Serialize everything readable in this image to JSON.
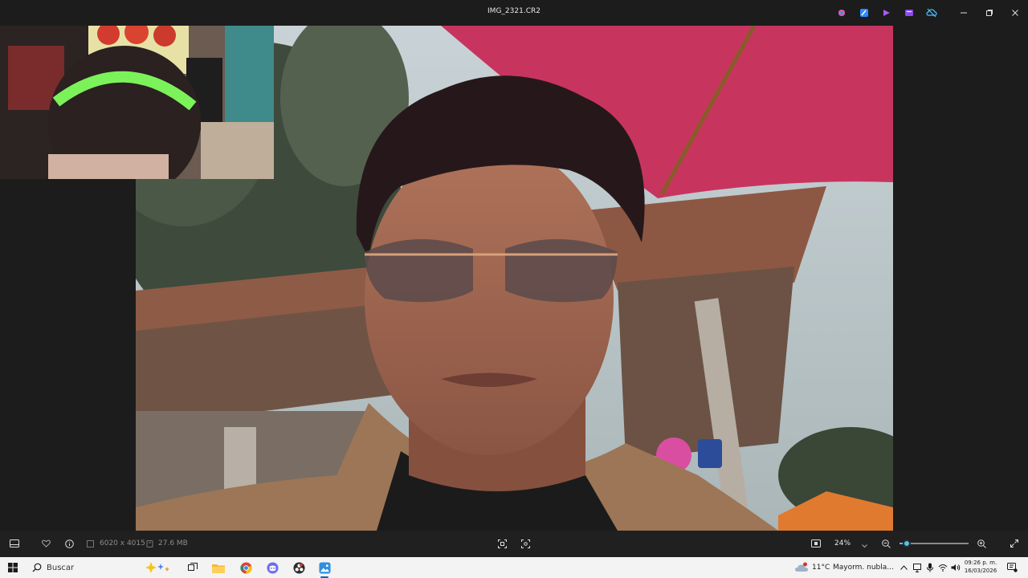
{
  "window": {
    "title": "IMG_2321.CR2",
    "app_icons": [
      "copilot-icon",
      "paint-icon",
      "clipchamp-icon",
      "video-editor-icon",
      "cloud-off-icon"
    ],
    "controls": [
      "minimize-icon",
      "restore-icon",
      "close-icon"
    ]
  },
  "viewer": {
    "image_file": "IMG_2321.CR2"
  },
  "toolbar": {
    "dimensions": "6020 x 4015",
    "file_size": "27.6 MB",
    "zoom": "24%",
    "zoom_level": 0.1
  },
  "taskbar": {
    "search_placeholder": "Buscar",
    "apps": [
      "task-view-icon",
      "file-explorer-icon",
      "chrome-icon",
      "discord-icon",
      "obs-icon",
      "photos-icon"
    ],
    "weather_temp": "11°C",
    "weather_text": "Mayorm. nubla...",
    "time": "09:26 p. m.",
    "date": "16/03/2026"
  },
  "colors": {
    "accent": "#4cc2ff",
    "taskbar_accent": "#0067c0",
    "window_bg": "#1c1c1c",
    "toolbar_bg": "#202020",
    "taskbar_bg": "#f3f3f3"
  }
}
